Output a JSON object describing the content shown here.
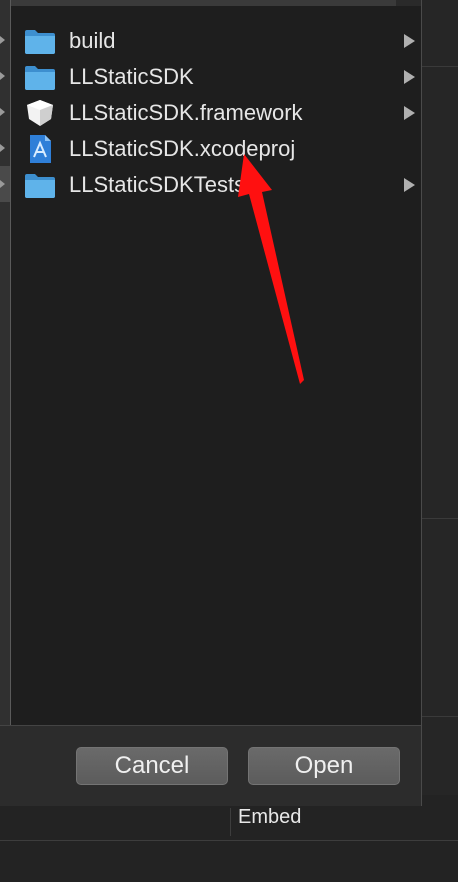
{
  "dialog": {
    "files": [
      {
        "name": "build",
        "icon": "folder-icon",
        "has_children": true
      },
      {
        "name": "LLStaticSDK",
        "icon": "folder-icon",
        "has_children": true
      },
      {
        "name": "LLStaticSDK.framework",
        "icon": "framework-icon",
        "has_children": true
      },
      {
        "name": "LLStaticSDK.xcodeproj",
        "icon": "xcodeproj-icon",
        "has_children": false
      },
      {
        "name": "LLStaticSDKTests",
        "icon": "folder-icon",
        "has_children": true
      }
    ],
    "cancel_label": "Cancel",
    "open_label": "Open"
  },
  "background": {
    "embed_label": "Embed"
  },
  "colors": {
    "folder": "#4aa3e0",
    "annotation_arrow": "#ff1010",
    "button": "#636363"
  }
}
